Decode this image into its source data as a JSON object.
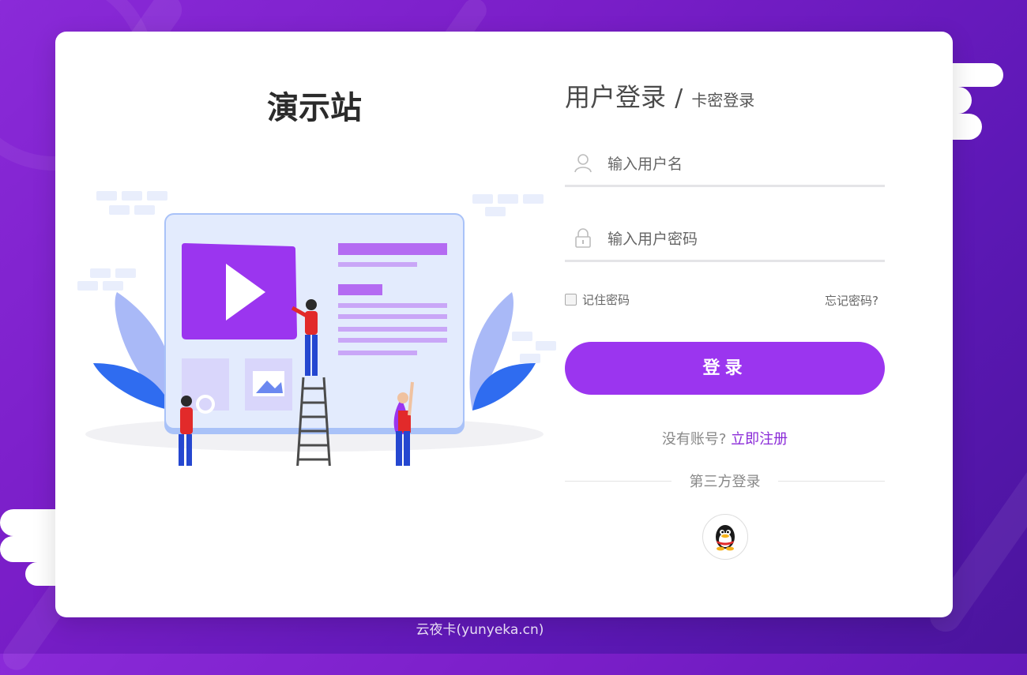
{
  "site": {
    "title": "演示站"
  },
  "login": {
    "title": "用户登录",
    "separator": "/",
    "alt_title": "卡密登录",
    "username_placeholder": "输入用户名",
    "password_placeholder": "输入用户密码",
    "remember_label": "记住密码",
    "forgot_label": "忘记密码?",
    "submit_label": "登录",
    "no_account_text": "没有账号?",
    "register_link": "立即注册",
    "third_party_label": "第三方登录"
  },
  "footer": {
    "text": "云夜卡(yunyeka.cn)"
  },
  "colors": {
    "accent": "#9b35ef",
    "link": "#8a2ad8",
    "bg_start": "#8a2ad8",
    "bg_end": "#4a149d"
  },
  "icons": {
    "username": "user-icon",
    "password": "lock-icon",
    "third_party": "qq-penguin-icon"
  }
}
